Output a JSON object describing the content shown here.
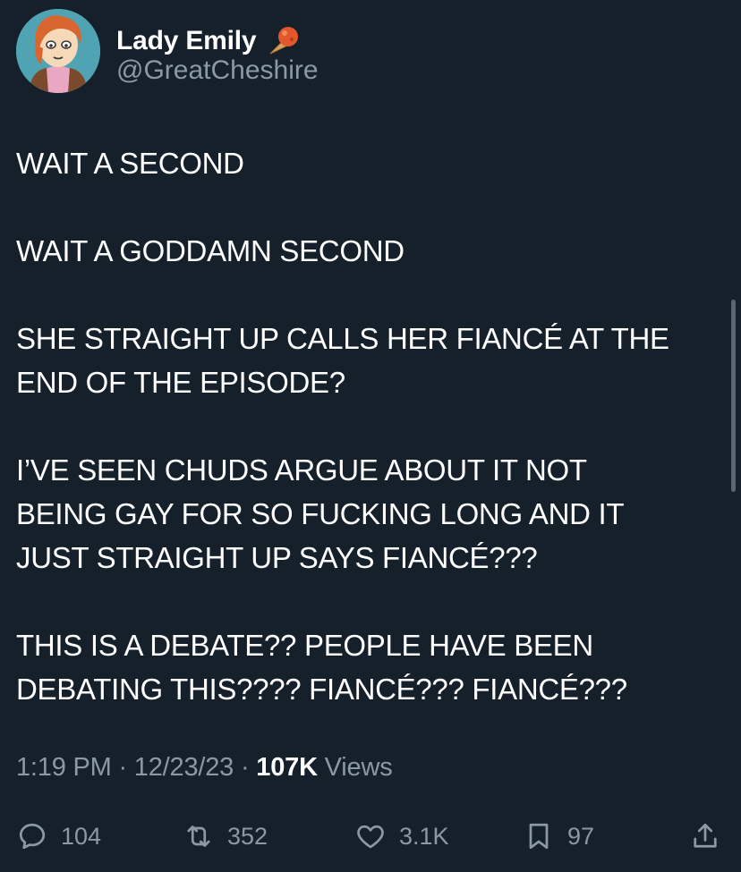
{
  "author": {
    "display_name": "Lady Emily",
    "handle": "@GreatCheshire",
    "avatar_icon": "cartoon-avatar",
    "badge_icon": "ice-cream-cone-emoji"
  },
  "tweet": {
    "paragraphs": [
      "WAIT A SECOND",
      "WAIT A GODDAMN SECOND",
      "SHE STRAIGHT UP CALLS HER FIANCÉ AT THE\nEND OF THE EPISODE?",
      "I’VE SEEN CHUDS ARGUE ABOUT IT NOT\nBEING GAY FOR SO FUCKING LONG AND IT\nJUST STRAIGHT UP SAYS FIANCÉ???",
      "THIS IS A DEBATE?? PEOPLE HAVE BEEN\nDEBATING THIS???? FIANCÉ??? FIANCÉ???"
    ]
  },
  "meta": {
    "time": "1:19 PM",
    "date": "12/23/23",
    "views_count": "107K",
    "views_label": "Views",
    "separator": "·"
  },
  "actions": {
    "replies": "104",
    "retweets": "352",
    "likes": "3.1K",
    "bookmarks": "97"
  },
  "colors": {
    "background": "#15202b",
    "text": "#ffffff",
    "secondary": "#8b98a5"
  }
}
